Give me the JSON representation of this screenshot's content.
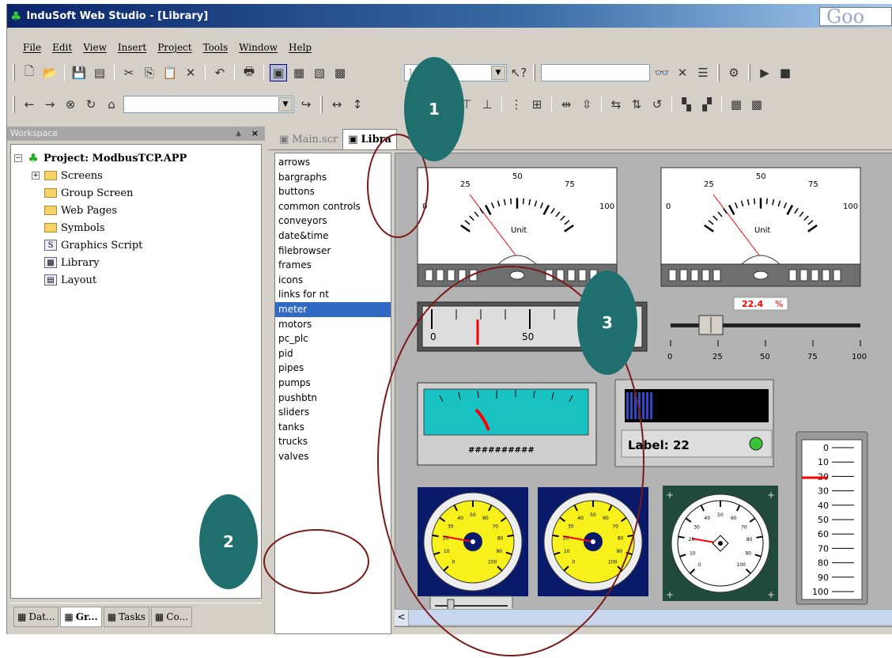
{
  "window": {
    "title": "InduSoft Web Studio - [Library]",
    "google_text": "Goo"
  },
  "menu": [
    "File",
    "Edit",
    "View",
    "Insert",
    "Project",
    "Tools",
    "Window",
    "Help"
  ],
  "toolbar": {
    "zoom": "100%",
    "search_value": ""
  },
  "workspace": {
    "header": "Workspace",
    "close": "×",
    "tree": [
      {
        "label": "Project: ModbusTCP.APP",
        "icon": "project-icon",
        "expand": "−",
        "level": 0,
        "bold": true
      },
      {
        "label": "Screens",
        "icon": "folder-icon",
        "expand": "+",
        "level": 1
      },
      {
        "label": "Group Screen",
        "icon": "folder-icon",
        "level": 1
      },
      {
        "label": "Web Pages",
        "icon": "folder-icon",
        "level": 1
      },
      {
        "label": "Symbols",
        "icon": "folder-icon",
        "level": 1
      },
      {
        "label": "Graphics Script",
        "icon": "script-icon",
        "level": 1
      },
      {
        "label": "Library",
        "icon": "library-icon",
        "level": 1
      },
      {
        "label": "Layout",
        "icon": "layout-icon",
        "level": 1
      }
    ],
    "tabs": [
      {
        "label": "Dat...",
        "active": false
      },
      {
        "label": "Gr...",
        "active": true
      },
      {
        "label": "Tasks",
        "active": false
      },
      {
        "label": "Co...",
        "active": false
      }
    ]
  },
  "doc_tabs": [
    {
      "label": "Main.scr",
      "active": false
    },
    {
      "label": "Libra",
      "active": true
    }
  ],
  "library_categories": [
    "arrows",
    "bargraphs",
    "buttons",
    "common controls",
    "conveyors",
    "date&time",
    "filebrowser",
    "frames",
    "icons",
    "links for nt",
    "meter",
    "motors",
    "pc_plc",
    "pid",
    "pipes",
    "pumps",
    "pushbtn",
    "sliders",
    "tanks",
    "trucks",
    "valves"
  ],
  "selected_category": "meter",
  "meters": {
    "analog_scale": [
      "0",
      "25",
      "50",
      "75",
      "100"
    ],
    "unit": "Unit",
    "linear_labels": [
      "0",
      "50"
    ],
    "slider_value": "22.4",
    "slider_unit": "%",
    "slider_ticks": [
      "0",
      "25",
      "50",
      "75",
      "100"
    ],
    "hash_text": "##########",
    "label_text": "Label: 22",
    "vert_ticks": [
      "0",
      "10",
      "20",
      "30",
      "40",
      "50",
      "60",
      "70",
      "80",
      "90",
      "100"
    ],
    "dial_small_ticks": [
      "0",
      "10",
      "20",
      "30",
      "40",
      "50",
      "60",
      "70",
      "80",
      "90",
      "100"
    ]
  },
  "annotations": [
    "1",
    "2",
    "3"
  ],
  "colors": {
    "annotation": "#1f6f6f",
    "circle": "#7a1a1a",
    "accent": "#316ac5"
  }
}
